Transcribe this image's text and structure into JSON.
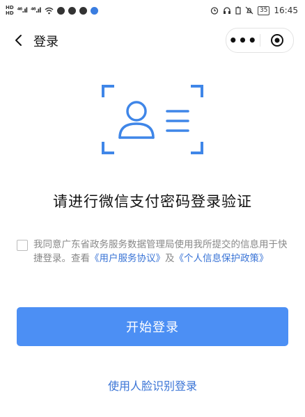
{
  "status_bar": {
    "hd1": "HD",
    "hd2": "HD",
    "signal1": "⁴⁶.ıl",
    "signal2": "⁴⁶.ıl",
    "time": "16:45",
    "battery": "35"
  },
  "nav": {
    "title": "登录",
    "more": "•••"
  },
  "headline": "请进行微信支付密码登录验证",
  "agreement": {
    "text_before": "我同意广东省政务服务数据管理局使用我所提交的信息用于快捷登录。查看",
    "link1": "《用户服务协议》",
    "and": "及",
    "link2": "《个人信息保护政策》"
  },
  "start_button": "开始登录",
  "face_login_link": "使用人脸识别登录",
  "colors": {
    "accent": "#4c8ff4",
    "link": "#3a74d6",
    "illustration": "#3f86e8"
  }
}
